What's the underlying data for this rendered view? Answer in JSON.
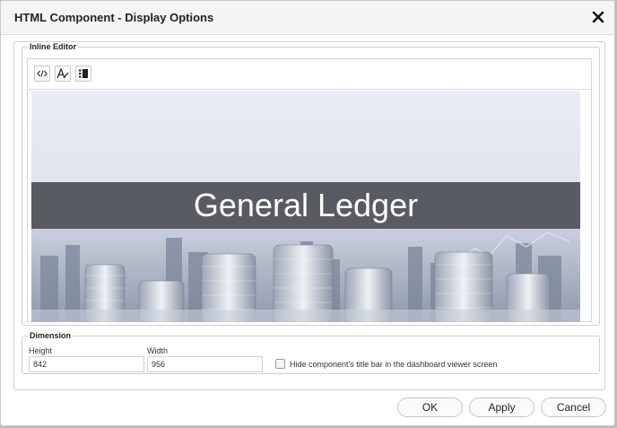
{
  "dialog": {
    "title": "HTML Component - Display Options",
    "close_icon": "close-icon"
  },
  "inline_editor": {
    "legend": "Inline Editor",
    "toolbar": [
      {
        "icon": "code-icon",
        "tooltip": ""
      },
      {
        "icon": "text-style-icon",
        "tooltip": ""
      },
      {
        "icon": "list-icon",
        "tooltip": ""
      }
    ],
    "banner_title": "General Ledger"
  },
  "dimension": {
    "legend": "Dimension",
    "height_label": "Height",
    "height_value": "842",
    "width_label": "Width",
    "width_value": "956",
    "hide_title_label": "Hide component's title bar in the dashboard viewer screen",
    "hide_title_checked": false
  },
  "footer": {
    "ok_label": "OK",
    "apply_label": "Apply",
    "cancel_label": "Cancel"
  },
  "colors": {
    "banner_strip": "#46484e",
    "banner_sky": "#e3e7ef"
  }
}
